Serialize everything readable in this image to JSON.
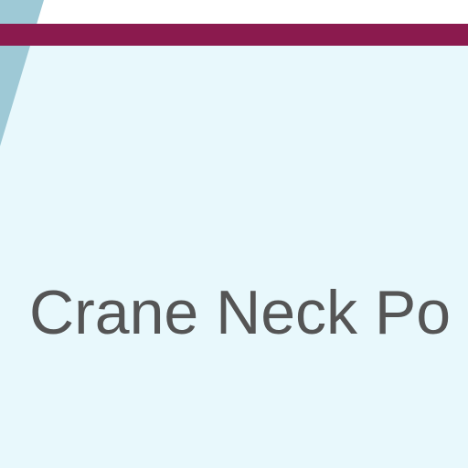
{
  "map": {
    "place_label": "Crane Neck Po",
    "colors": {
      "background": "#e8f8fc",
      "route_line": "#8b1a4e",
      "water_wedge": "#9ec9d6",
      "label_text": "#555555"
    }
  }
}
